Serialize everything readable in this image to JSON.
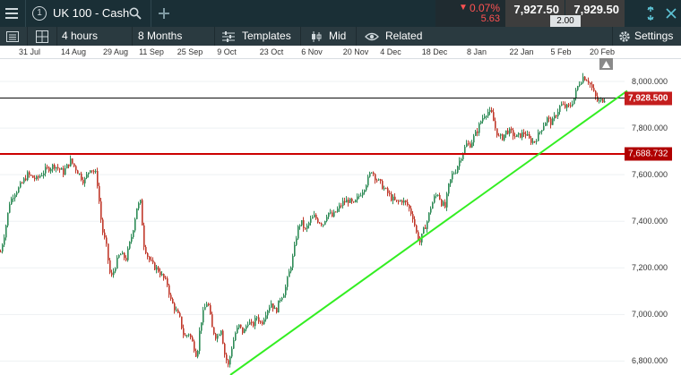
{
  "top_bar": {
    "instrument_number": "1",
    "instrument_name": "UK 100 - Cash",
    "change_percent": "0.07%",
    "change_points": "5.63",
    "sell_price": "7,927.50",
    "buy_price": "7,929.50",
    "spread": "2.00"
  },
  "toolbar": {
    "interval": "4 hours",
    "range": "8 Months",
    "templates_label": "Templates",
    "price_type": "Mid",
    "related_label": "Related",
    "settings_label": "Settings"
  },
  "icons": {
    "menu": "hamburger-icon",
    "search": "search-icon",
    "add": "plus-icon",
    "expand": "expand-icon",
    "collapse": "collapse-icon",
    "layout": "grid-icon",
    "templates": "sliders-icon",
    "price_type": "candles-icon",
    "related": "eye-icon",
    "settings": "gear-icon"
  },
  "colors": {
    "up": "#2e8b57",
    "down": "#c0392b",
    "trendline": "#33ee22",
    "horizontal_line": "#cc0000",
    "current_price_line": "#000000",
    "negative_change": "#ff5252"
  },
  "chart_data": {
    "type": "candlestick",
    "x_tick_labels": [
      "31 Jul",
      "14 Aug",
      "29 Aug",
      "11 Sep",
      "25 Sep",
      "9 Oct",
      "23 Oct",
      "6 Nov",
      "20 Nov",
      "4 Dec",
      "18 Dec",
      "8 Jan",
      "22 Jan",
      "5 Feb",
      "20 Feb"
    ],
    "y_tick_labels": [
      "8,000.000",
      "7,800.000",
      "7,600.000",
      "7,400.000",
      "7,200.000",
      "7,000.000",
      "6,800.000"
    ],
    "y_ticks": [
      8000,
      7800,
      7600,
      7400,
      7200,
      7000,
      6800
    ],
    "ylim": [
      6740,
      8100
    ],
    "current_price": 7928.5,
    "current_price_label": "7,928.500",
    "horizontal_level": 7688.732,
    "horizontal_level_label": "7,688.732",
    "price_path": [
      [
        0,
        7270
      ],
      [
        5,
        7360
      ],
      [
        10,
        7480
      ],
      [
        15,
        7520
      ],
      [
        20,
        7540
      ],
      [
        30,
        7600
      ],
      [
        40,
        7580
      ],
      [
        50,
        7620
      ],
      [
        60,
        7640
      ],
      [
        70,
        7610
      ],
      [
        78,
        7660
      ],
      [
        85,
        7620
      ],
      [
        93,
        7570
      ],
      [
        100,
        7630
      ],
      [
        107,
        7600
      ],
      [
        113,
        7370
      ],
      [
        118,
        7290
      ],
      [
        123,
        7150
      ],
      [
        128,
        7210
      ],
      [
        133,
        7260
      ],
      [
        140,
        7240
      ],
      [
        147,
        7350
      ],
      [
        152,
        7460
      ],
      [
        156,
        7480
      ],
      [
        160,
        7300
      ],
      [
        165,
        7240
      ],
      [
        170,
        7210
      ],
      [
        176,
        7190
      ],
      [
        181,
        7160
      ],
      [
        186,
        7130
      ],
      [
        190,
        7060
      ],
      [
        195,
        7020
      ],
      [
        200,
        6980
      ],
      [
        205,
        6900
      ],
      [
        210,
        6920
      ],
      [
        215,
        6870
      ],
      [
        219,
        6820
      ],
      [
        223,
        6960
      ],
      [
        227,
        7020
      ],
      [
        231,
        7060
      ],
      [
        236,
        6940
      ],
      [
        241,
        6900
      ],
      [
        246,
        6940
      ],
      [
        250,
        6830
      ],
      [
        254,
        6780
      ],
      [
        258,
        6860
      ],
      [
        262,
        6920
      ],
      [
        266,
        6950
      ],
      [
        271,
        6920
      ],
      [
        276,
        6970
      ],
      [
        281,
        6950
      ],
      [
        286,
        6990
      ],
      [
        291,
        6960
      ],
      [
        296,
        7010
      ],
      [
        302,
        7050
      ],
      [
        307,
        7010
      ],
      [
        312,
        7070
      ],
      [
        317,
        7100
      ],
      [
        322,
        7180
      ],
      [
        327,
        7260
      ],
      [
        331,
        7360
      ],
      [
        335,
        7400
      ],
      [
        340,
        7360
      ],
      [
        345,
        7400
      ],
      [
        350,
        7420
      ],
      [
        355,
        7400
      ],
      [
        360,
        7390
      ],
      [
        365,
        7440
      ],
      [
        370,
        7420
      ],
      [
        376,
        7450
      ],
      [
        382,
        7480
      ],
      [
        388,
        7490
      ],
      [
        394,
        7470
      ],
      [
        400,
        7510
      ],
      [
        405,
        7540
      ],
      [
        410,
        7580
      ],
      [
        414,
        7620
      ],
      [
        418,
        7590
      ],
      [
        424,
        7560
      ],
      [
        430,
        7530
      ],
      [
        436,
        7500
      ],
      [
        442,
        7480
      ],
      [
        448,
        7490
      ],
      [
        454,
        7470
      ],
      [
        460,
        7420
      ],
      [
        464,
        7350
      ],
      [
        468,
        7310
      ],
      [
        472,
        7360
      ],
      [
        476,
        7400
      ],
      [
        480,
        7460
      ],
      [
        484,
        7500
      ],
      [
        488,
        7520
      ],
      [
        492,
        7480
      ],
      [
        496,
        7460
      ],
      [
        500,
        7550
      ],
      [
        504,
        7600
      ],
      [
        508,
        7620
      ],
      [
        512,
        7660
      ],
      [
        516,
        7700
      ],
      [
        520,
        7730
      ],
      [
        524,
        7730
      ],
      [
        528,
        7760
      ],
      [
        532,
        7790
      ],
      [
        536,
        7830
      ],
      [
        540,
        7860
      ],
      [
        544,
        7870
      ],
      [
        548,
        7860
      ],
      [
        552,
        7800
      ],
      [
        556,
        7760
      ],
      [
        560,
        7760
      ],
      [
        565,
        7790
      ],
      [
        570,
        7780
      ],
      [
        575,
        7760
      ],
      [
        580,
        7770
      ],
      [
        585,
        7780
      ],
      [
        590,
        7750
      ],
      [
        595,
        7740
      ],
      [
        600,
        7770
      ],
      [
        605,
        7810
      ],
      [
        610,
        7840
      ],
      [
        615,
        7820
      ],
      [
        620,
        7860
      ],
      [
        625,
        7900
      ],
      [
        630,
        7890
      ],
      [
        635,
        7890
      ],
      [
        640,
        7930
      ],
      [
        645,
        7990
      ],
      [
        650,
        8020
      ],
      [
        655,
        8010
      ],
      [
        659,
        7980
      ],
      [
        663,
        7940
      ],
      [
        667,
        7910
      ],
      [
        671,
        7920
      ],
      [
        675,
        7930
      ]
    ],
    "trendline": {
      "start": [
        257,
        6740
      ],
      "end": [
        700,
        7960
      ]
    }
  }
}
